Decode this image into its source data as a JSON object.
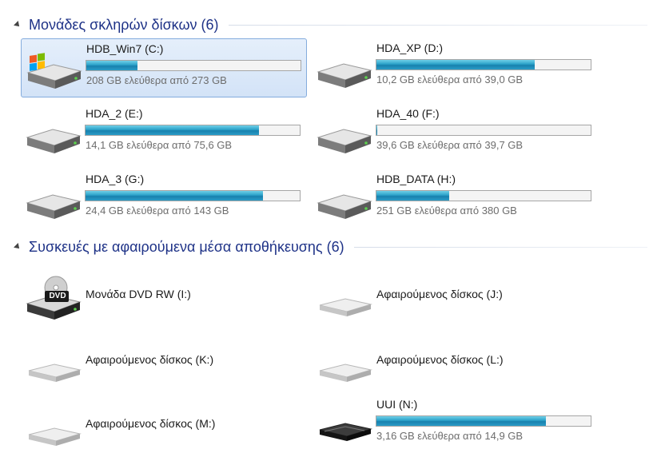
{
  "groups": {
    "hard_disks": {
      "title": "Μονάδες σκληρών δίσκων (6)"
    },
    "removable": {
      "title": "Συσκευές με αφαιρούμενα μέσα αποθήκευσης (6)"
    }
  },
  "hard_disks": [
    {
      "name": "HDB_Win7 (C:)",
      "free_text": "208 GB ελεύθερα από 273 GB",
      "used_fraction": 0.24,
      "icon": "windows-drive-icon",
      "selected": true
    },
    {
      "name": "HDA_XP (D:)",
      "free_text": "10,2 GB ελεύθερα από 39,0 GB",
      "used_fraction": 0.74,
      "icon": "hard-disk-icon",
      "selected": false
    },
    {
      "name": "HDA_2 (E:)",
      "free_text": "14,1 GB ελεύθερα από 75,6 GB",
      "used_fraction": 0.81,
      "icon": "hard-disk-icon",
      "selected": false
    },
    {
      "name": "HDA_40 (F:)",
      "free_text": "39,6 GB ελεύθερα από 39,7 GB",
      "used_fraction": 0.003,
      "icon": "hard-disk-icon",
      "selected": false
    },
    {
      "name": "HDA_3 (G:)",
      "free_text": "24,4 GB ελεύθερα από 143 GB",
      "used_fraction": 0.83,
      "icon": "hard-disk-icon",
      "selected": false
    },
    {
      "name": "HDB_DATA (H:)",
      "free_text": "251 GB ελεύθερα από 380 GB",
      "used_fraction": 0.34,
      "icon": "hard-disk-icon",
      "selected": false
    }
  ],
  "removable": [
    {
      "name": "Μονάδα DVD RW (I:)",
      "icon": "dvd-drive-icon",
      "dvd_label": "DVD"
    },
    {
      "name": "Αφαιρούμενος δίσκος (J:)",
      "icon": "removable-disk-icon"
    },
    {
      "name": "Αφαιρούμενος δίσκος (K:)",
      "icon": "removable-disk-icon"
    },
    {
      "name": "Αφαιρούμενος δίσκος (L:)",
      "icon": "removable-disk-icon"
    },
    {
      "name": "Αφαιρούμενος δίσκος (M:)",
      "icon": "removable-disk-icon"
    },
    {
      "name": "UUI (N:)",
      "free_text": "3,16 GB ελεύθερα από 14,9 GB",
      "used_fraction": 0.79,
      "icon": "usb-drive-icon"
    }
  ],
  "colors": {
    "header_text": "#1e3287",
    "selection_border": "#84acdd",
    "bar_fill": "#1f93c0"
  }
}
